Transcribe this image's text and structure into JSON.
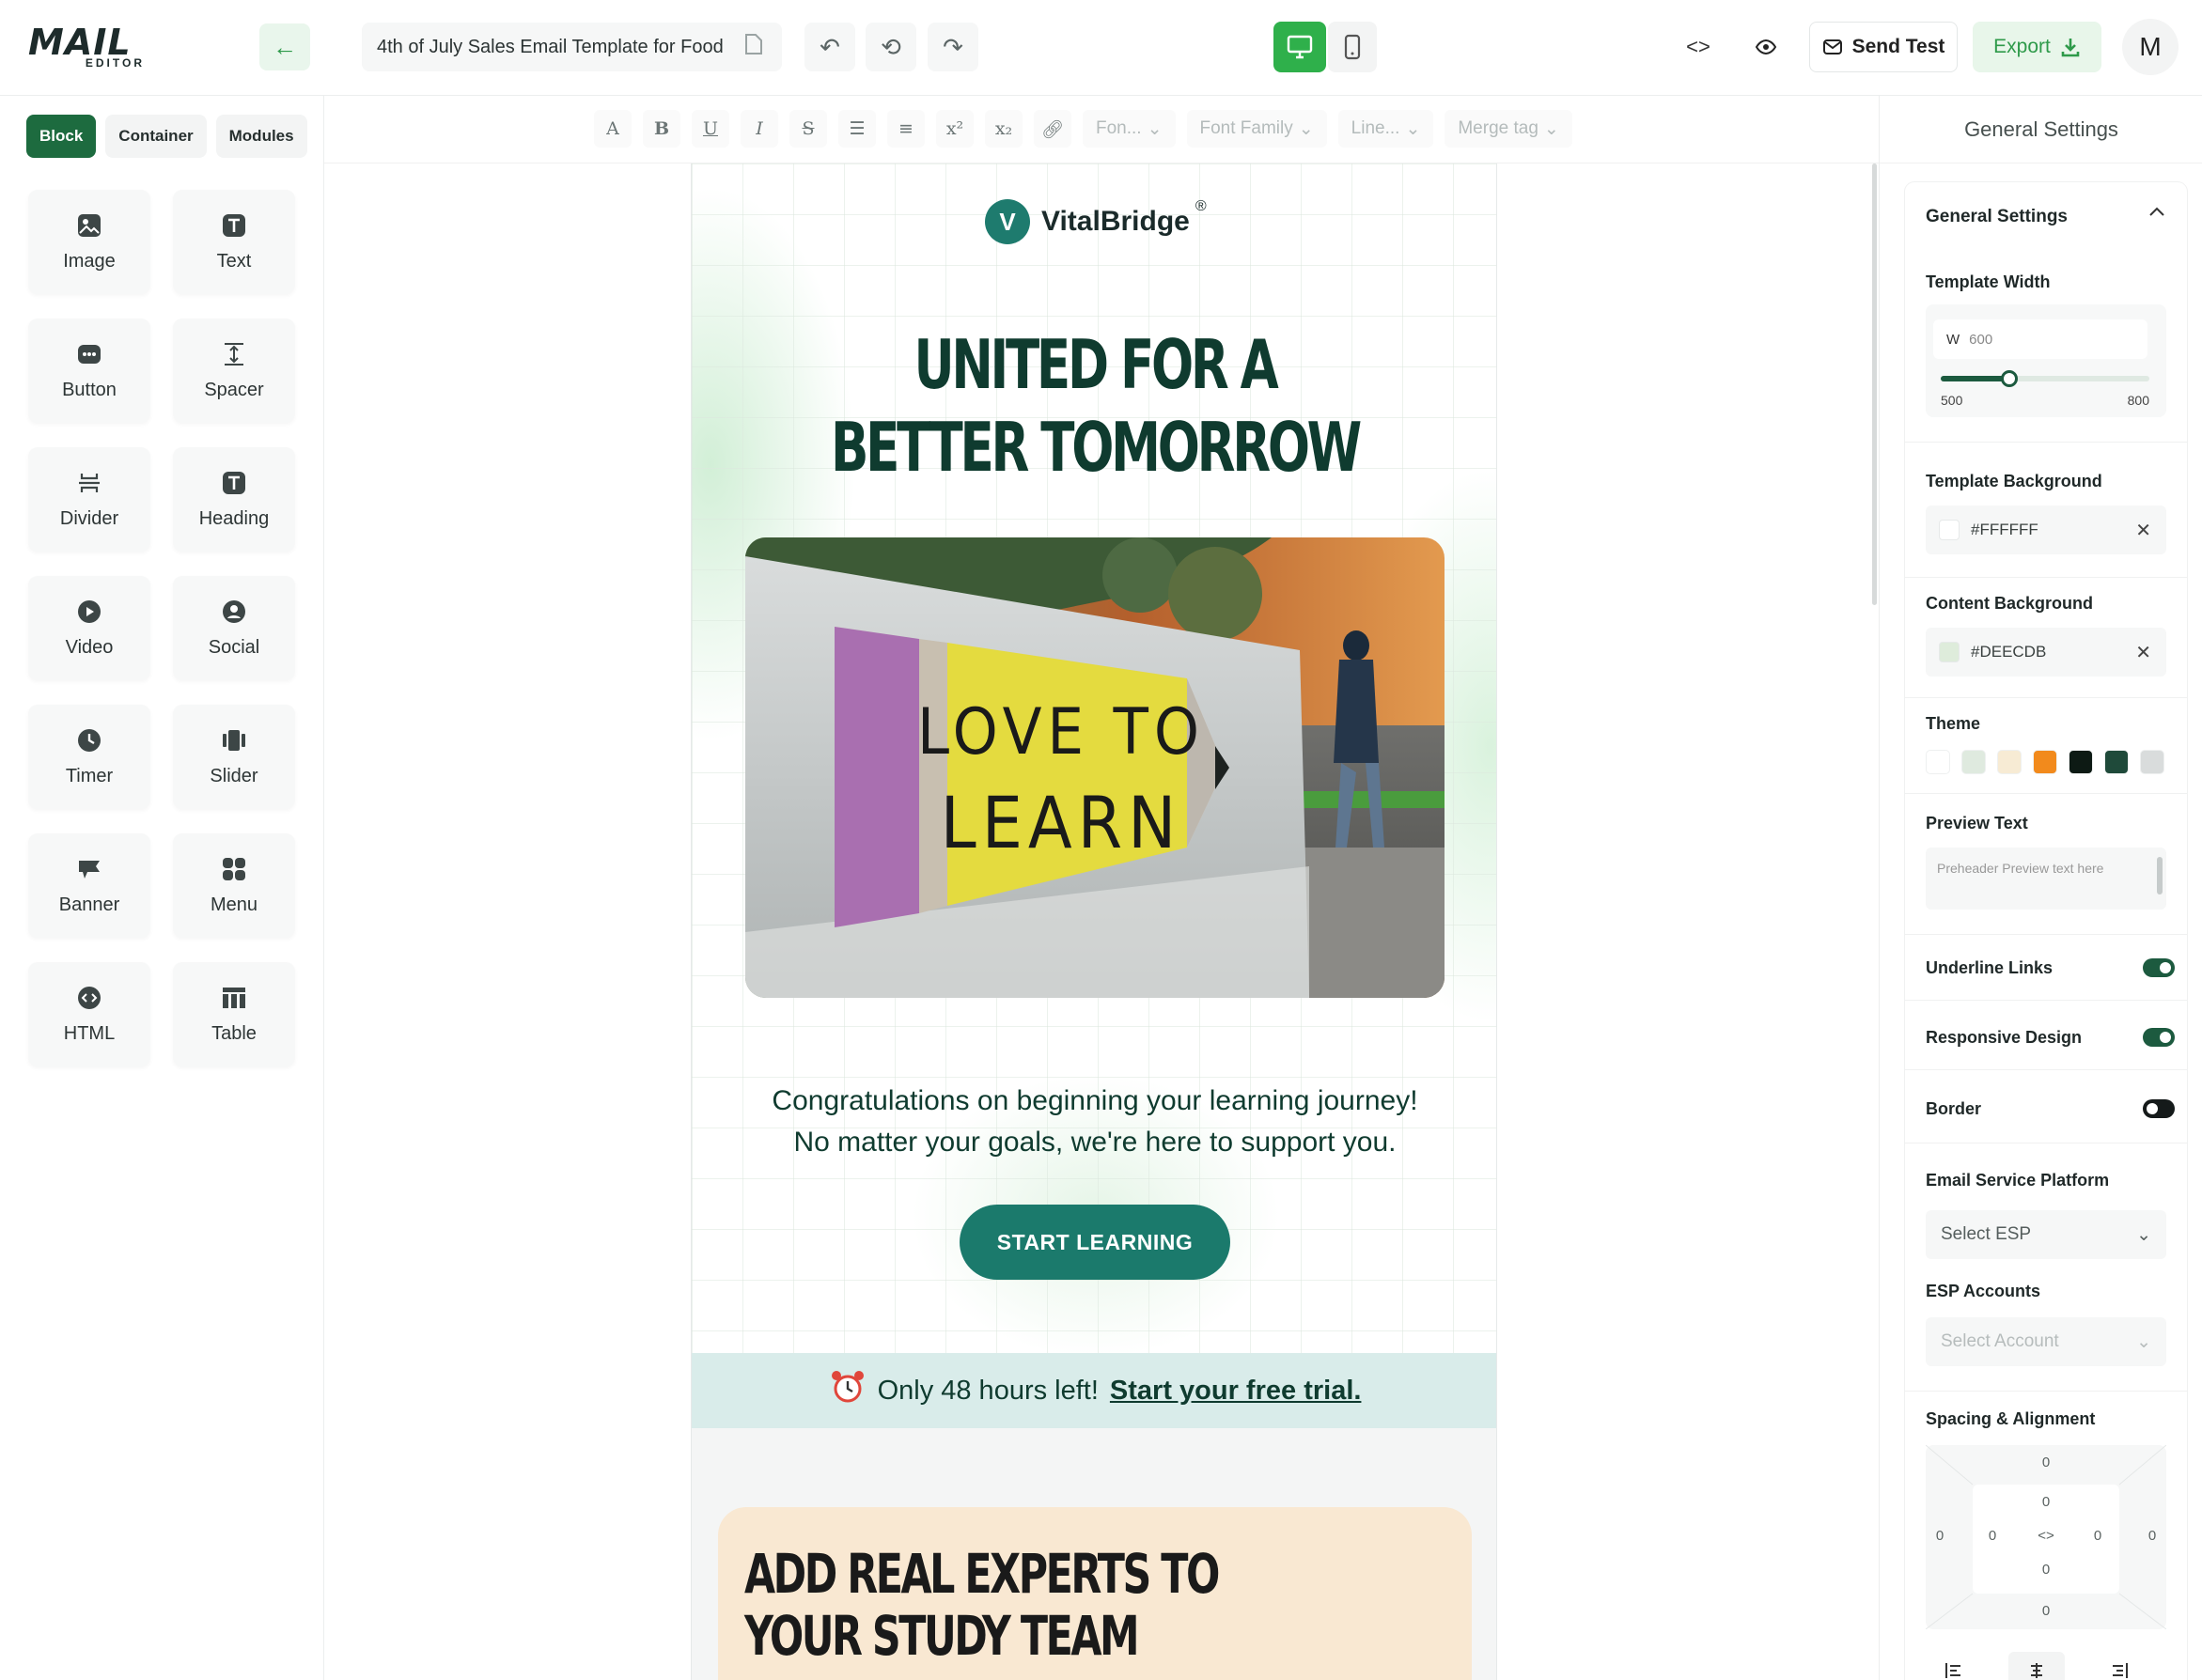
{
  "app": {
    "logo_text": "MAIL",
    "logo_sub": "EDITOR",
    "template_title": "4th of July Sales Email Template for Food",
    "send_test_label": "Send Test",
    "export_label": "Export",
    "avatar_initial": "M",
    "accent_color": "#2fb04b"
  },
  "left_panel": {
    "tabs": [
      {
        "label": "Block",
        "active": true
      },
      {
        "label": "Container",
        "active": false
      },
      {
        "label": "Modules",
        "active": false
      }
    ],
    "blocks": [
      {
        "label": "Image",
        "icon": "image-icon"
      },
      {
        "label": "Text",
        "icon": "text-icon"
      },
      {
        "label": "Button",
        "icon": "button-icon"
      },
      {
        "label": "Spacer",
        "icon": "spacer-icon"
      },
      {
        "label": "Divider",
        "icon": "divider-icon"
      },
      {
        "label": "Heading",
        "icon": "heading-icon"
      },
      {
        "label": "Video",
        "icon": "video-icon"
      },
      {
        "label": "Social",
        "icon": "social-icon"
      },
      {
        "label": "Timer",
        "icon": "timer-icon"
      },
      {
        "label": "Slider",
        "icon": "slider-icon"
      },
      {
        "label": "Banner",
        "icon": "banner-icon"
      },
      {
        "label": "Menu",
        "icon": "menu-icon"
      },
      {
        "label": "HTML",
        "icon": "html-icon"
      },
      {
        "label": "Table",
        "icon": "table-icon"
      }
    ]
  },
  "format_toolbar": {
    "font_size_placeholder": "Fon...",
    "font_family_placeholder": "Font Family",
    "line_height_placeholder": "Line...",
    "merge_tag_placeholder": "Merge tag"
  },
  "email": {
    "brand_initial": "V",
    "brand_name": "VitalBridge",
    "brand_mark": "®",
    "headline_line1": "UNITED FOR A",
    "headline_line2": "BETTER TOMORROW",
    "sign_line1": "LOVE TO",
    "sign_line2": "LEARN",
    "body_line1": "Congratulations on beginning your learning journey!",
    "body_line2": "No matter your goals, we're here to support you.",
    "cta_label": "START LEARNING",
    "banner_text": "Only 48 hours left!",
    "banner_link": "Start your free trial.",
    "experts_title": "ADD REAL EXPERTS TO\nYOUR STUDY TEAM"
  },
  "right_panel": {
    "header": "General Settings",
    "section_title": "General Settings",
    "template_width_label": "Template Width",
    "width_prefix": "W",
    "width_value": "600",
    "width_min": "500",
    "width_max": "800",
    "width_slider_fraction": 0.33,
    "template_bg_label": "Template Background",
    "template_bg_value": "#FFFFFF",
    "content_bg_label": "Content Background",
    "content_bg_value": "#DEECDB",
    "theme_label": "Theme",
    "theme_colors": [
      "#ffffff",
      "#dfeadf",
      "#f7ebd4",
      "#f28a1c",
      "#0d1a14",
      "#1f4a3a",
      "#d9dcdc"
    ],
    "preview_text_label": "Preview Text",
    "preview_text_placeholder": "Preheader Preview text here",
    "underline_links_label": "Underline Links",
    "underline_links_on": true,
    "responsive_label": "Responsive Design",
    "responsive_on": true,
    "border_label": "Border",
    "border_on": false,
    "esp_label": "Email Service Platform",
    "esp_placeholder": "Select ESP",
    "esp_accounts_label": "ESP Accounts",
    "esp_accounts_placeholder": "Select Account",
    "spacing_label": "Spacing & Alignment",
    "spacing_values": {
      "outer_top": "0",
      "outer_left": "0",
      "outer_right": "0",
      "outer_bottom": "0",
      "inner_top": "0",
      "inner_left": "0",
      "inner_right": "0",
      "inner_bottom": "0"
    }
  }
}
